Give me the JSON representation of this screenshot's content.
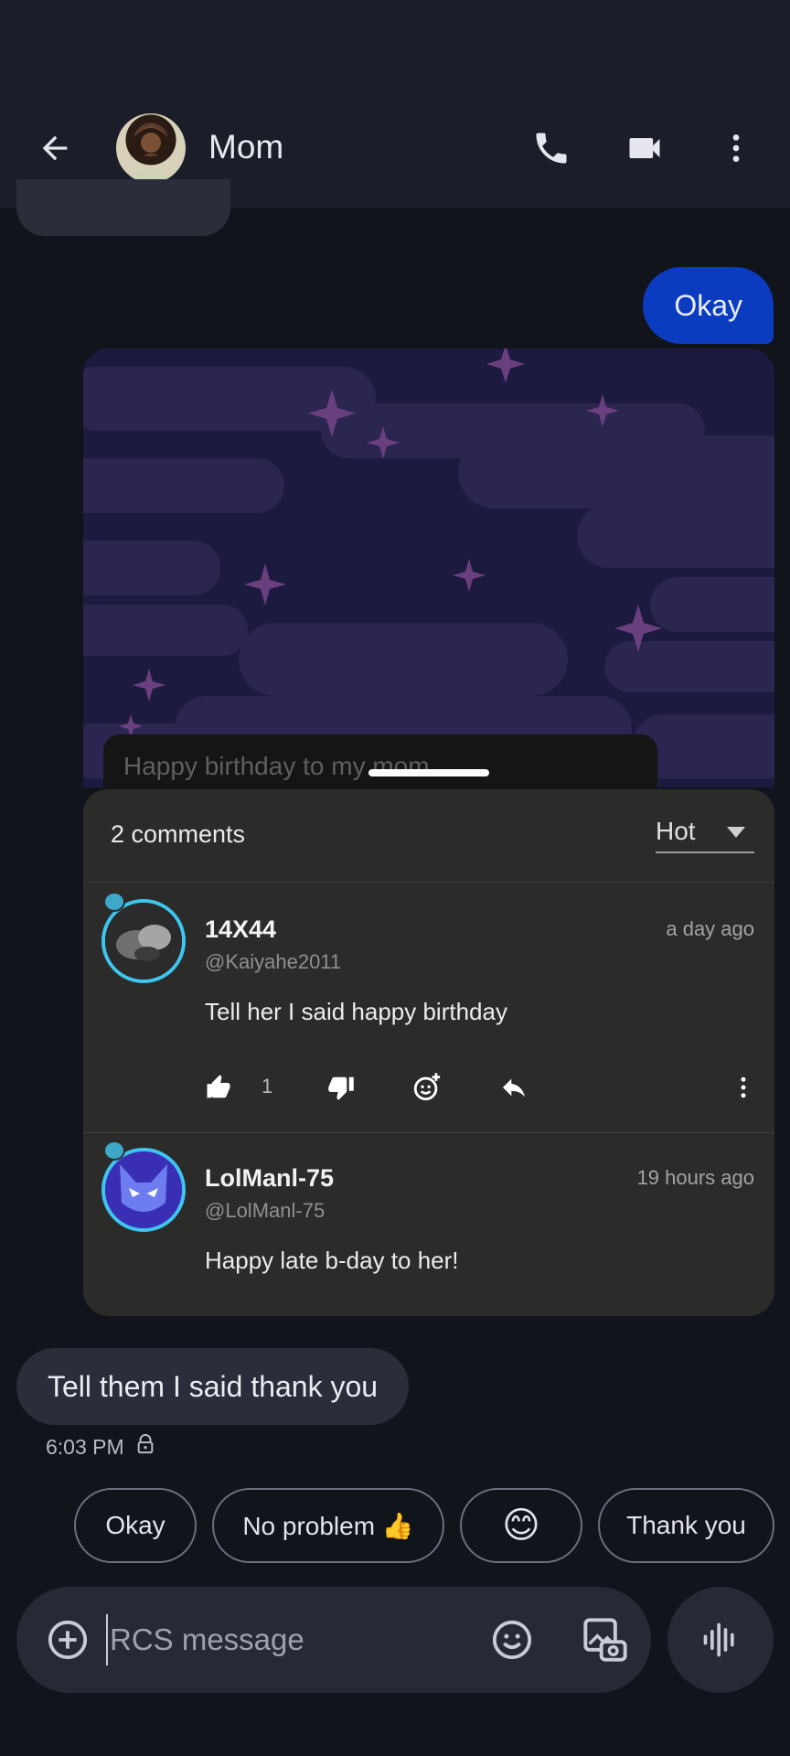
{
  "header": {
    "contact_name": "Mom",
    "icons": [
      "back-arrow-icon",
      "avatar",
      "phone-icon",
      "video-icon",
      "more-vert-icon"
    ]
  },
  "messages": {
    "outgoing_text": "Okay",
    "incoming_text": "Tell them I said thank you",
    "incoming_time": "6:03 PM"
  },
  "card": {
    "caption": "Happy birthday to my mom",
    "comments_count": "2 comments",
    "sort_value": "Hot",
    "comments": [
      {
        "name": "14X44",
        "handle": "@Kaiyahe2011",
        "time": "a day ago",
        "text": "Tell her I said happy birthday",
        "likes": "1"
      },
      {
        "name": "LolManl-75",
        "handle": "@LolManl-75",
        "time": "19 hours ago",
        "text": "Happy late b-day to her!"
      }
    ]
  },
  "smart_replies": [
    "Okay",
    "No problem 👍",
    "😊",
    "Thank you"
  ],
  "compose": {
    "placeholder": "RCS message"
  },
  "colors": {
    "background": "#12141c",
    "header": "#1b1e29",
    "outgoing_bubble": "#0b3bbf",
    "incoming_bubble": "#2a2d3a",
    "comments_panel": "#2b2c29",
    "avatar_ring": "#3ec6f0"
  }
}
